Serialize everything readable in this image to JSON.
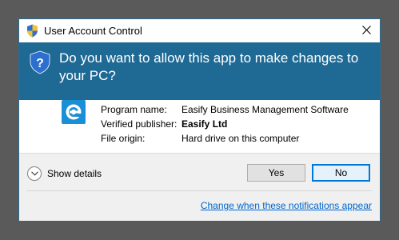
{
  "window": {
    "title": "User Account Control",
    "close_icon": "close-icon",
    "shield_icon": "uac-shield-icon"
  },
  "banner": {
    "question": "Do you want to allow this app to make changes to your PC?",
    "background": "#1f6a95"
  },
  "app": {
    "icon": "easify-logo-icon",
    "accent": "#1a8fd6",
    "fields": [
      {
        "label": "Program name:",
        "value": "Easify Business Management Software"
      },
      {
        "label": "Verified publisher:",
        "value": "Easify Ltd"
      },
      {
        "label": "File origin:",
        "value": "Hard drive on this computer"
      }
    ]
  },
  "actions": {
    "details_label": "Show details",
    "yes_label": "Yes",
    "no_label": "No",
    "notifications_link": "Change when these notifications appear"
  }
}
